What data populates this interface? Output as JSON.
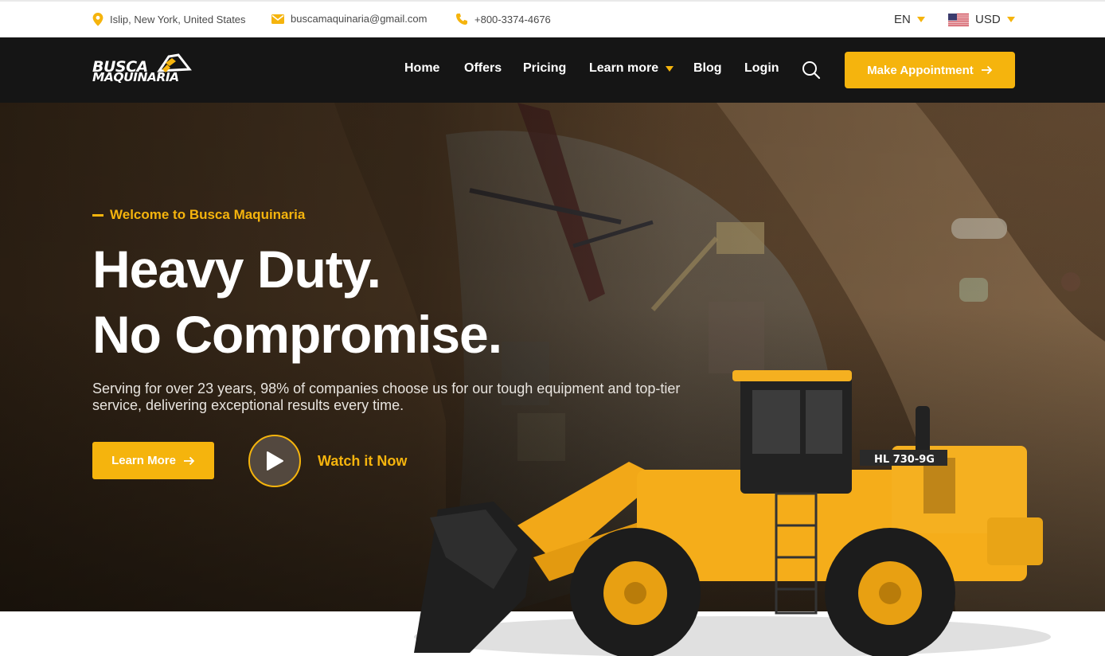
{
  "topbar": {
    "location": "Islip, New York, United States",
    "email": "buscamaquinaria@gmail.com",
    "phone": "+800-3374-4676",
    "language": "EN",
    "currency": "USD",
    "icons": {
      "location": "map-pin-icon",
      "email": "envelope-icon",
      "phone": "phone-icon",
      "flag": "us-flag-icon"
    }
  },
  "brand": {
    "logo_line1": "BUSCA",
    "logo_line2": "MAQUINARIA"
  },
  "nav": {
    "items": [
      "Home",
      "Offers",
      "Pricing",
      "Learn more",
      "Blog",
      "Login"
    ],
    "cta": "Make Appointment"
  },
  "hero": {
    "eyebrow": "Welcome to Busca Maquinaria",
    "headline_line1": "Heavy Duty.",
    "headline_line2": "No Compromise.",
    "subtext": "Serving for over 23 years, 98% of companies choose us for our tough equipment and top-tier service, delivering exceptional results every time.",
    "primary_button": "Learn More",
    "video_link": "Watch it Now",
    "loader_model": "HL 730-9G"
  },
  "colors": {
    "accent": "#f5b40d",
    "navbar": "#151515",
    "topbar_text": "#4a4a4a"
  }
}
